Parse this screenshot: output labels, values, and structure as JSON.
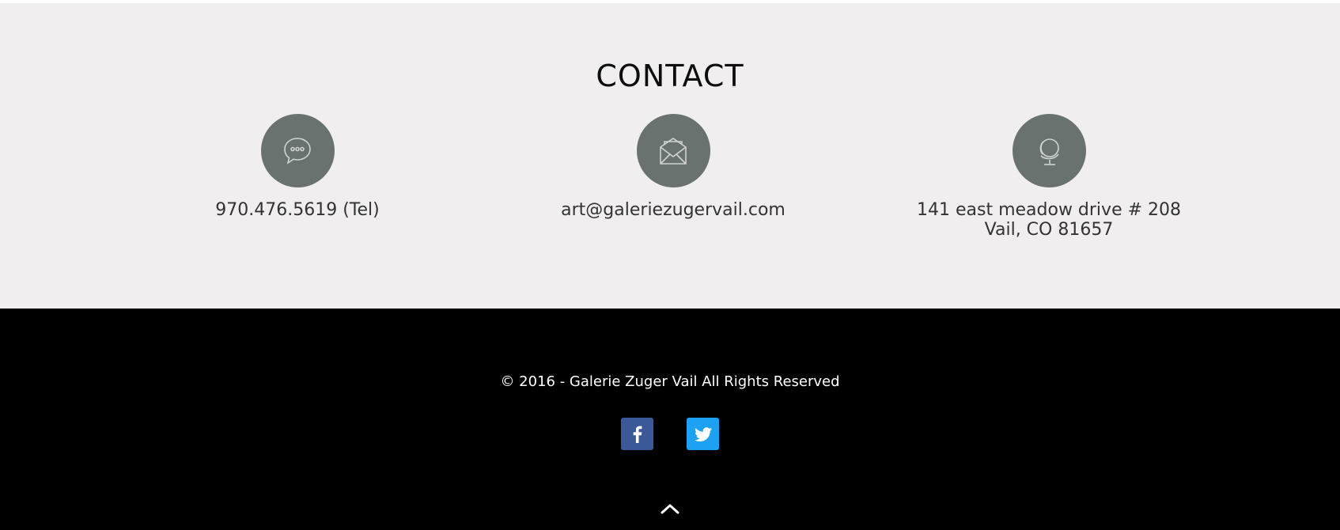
{
  "contact": {
    "title": "CONTACT",
    "items": [
      {
        "icon": "speech-bubble-icon",
        "text": "970.476.5619 (Tel)"
      },
      {
        "icon": "envelope-icon",
        "text": "art@galeriezugervail.com"
      },
      {
        "icon": "globe-icon",
        "line1": "141 east meadow drive # 208",
        "line2": "Vail, CO 81657"
      }
    ]
  },
  "footer": {
    "copyright": "© 2016 - Galerie Zuger Vail All Rights Reserved",
    "social": [
      {
        "icon": "facebook-icon",
        "color": "#3b5998"
      },
      {
        "icon": "twitter-icon",
        "color": "#1da1f2"
      }
    ],
    "back_to_top_icon": "chevron-up-icon"
  },
  "colors": {
    "contact_bg": "#f0eeee",
    "icon_circle": "#6a7270",
    "footer_bg": "#000000"
  }
}
